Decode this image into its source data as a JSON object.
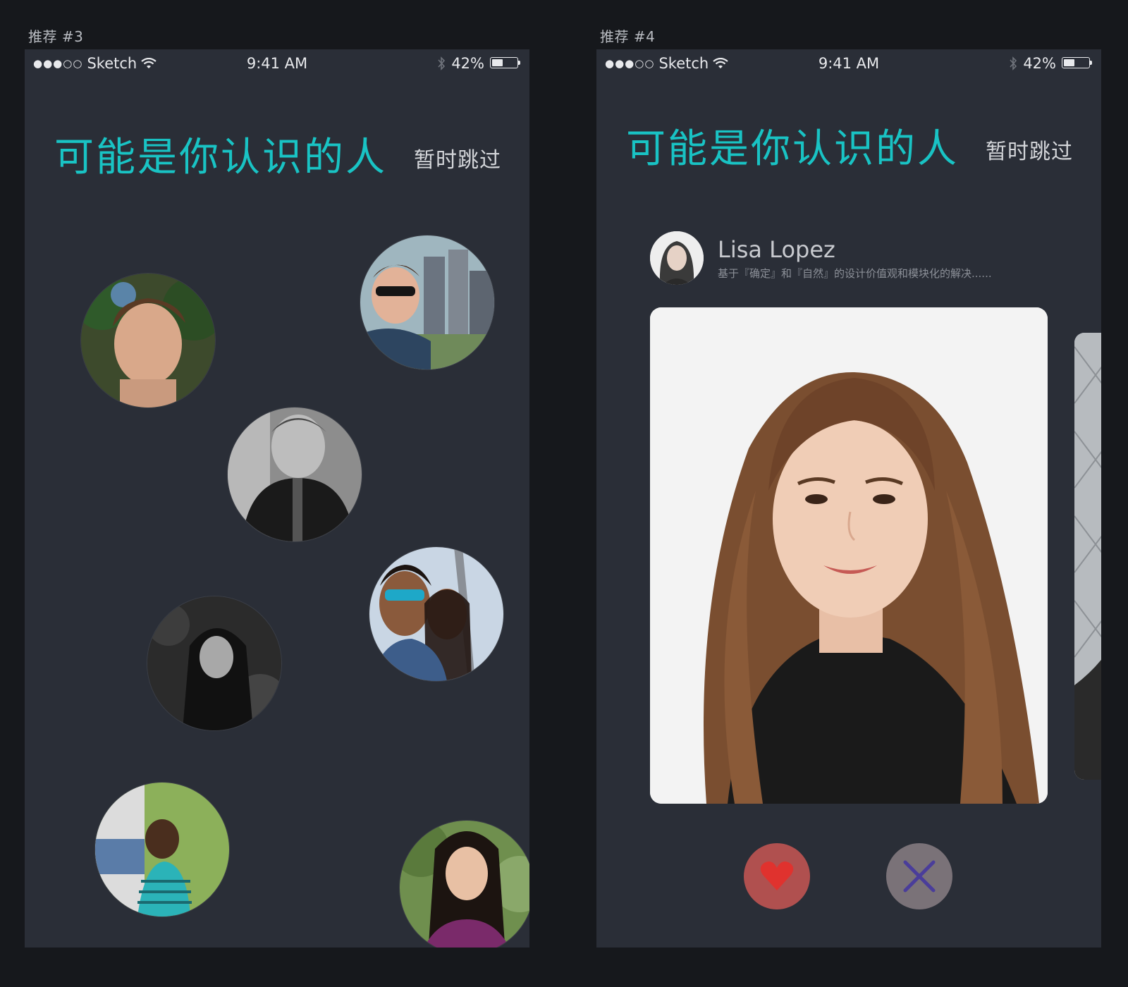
{
  "artboards": [
    {
      "label": "推荐 #3",
      "status": {
        "carrier": "Sketch",
        "signal": "●●●○○",
        "time": "9:41 AM",
        "battery": "42%"
      },
      "title": "可能是你认识的人",
      "skip": "暂时跳过"
    },
    {
      "label": "推荐 #4",
      "status": {
        "carrier": "Sketch",
        "signal": "●●●○○",
        "time": "9:41 AM",
        "battery": "42%"
      },
      "title": "可能是你认识的人",
      "skip": "暂时跳过",
      "profile": {
        "name": "Lisa Lopez",
        "bio": "基于『确定』和『自然』的设计价值观和模块化的解决......"
      },
      "actions": {
        "like_icon": "heart-icon",
        "dismiss_icon": "close-icon"
      }
    }
  ],
  "colors": {
    "background": "#16181c",
    "screen": "#2a2e37",
    "accent": "#19c3c4",
    "like": "#b0504f",
    "like_icon": "#e0322e",
    "dismiss": "#7a7278",
    "dismiss_icon": "#4a3d9a"
  }
}
